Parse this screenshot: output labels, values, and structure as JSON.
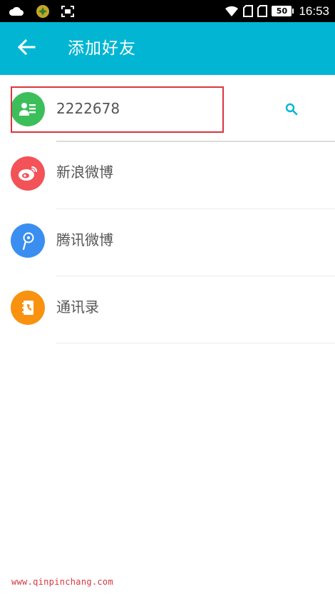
{
  "status_bar": {
    "battery_level": "50",
    "time": "16:53",
    "left_icons": [
      "cloud-icon",
      "app-notification-icon",
      "screenshot-icon"
    ],
    "right_icons": [
      "wifi-icon",
      "sim-card-1-icon",
      "sim-card-2-icon",
      "battery-icon"
    ]
  },
  "app_bar": {
    "title": "添加好友",
    "back_icon": "arrow-left-icon",
    "background_color": "#02b6d3"
  },
  "list": {
    "items": [
      {
        "label": "2222678",
        "icon": "contact-card-icon",
        "color": "#3cbf5a",
        "trailing_icon": "search-icon"
      },
      {
        "label": "新浪微博",
        "icon": "weibo-icon",
        "color": "#f25258"
      },
      {
        "label": "腾讯微博",
        "icon": "tencent-weibo-icon",
        "color": "#3a8ef0"
      },
      {
        "label": "通讯录",
        "icon": "address-book-icon",
        "color": "#f8920f"
      }
    ]
  },
  "accent_color": "#02b6d3",
  "highlight_color": "#d9363e",
  "watermark": "www.qinpinchang.com"
}
